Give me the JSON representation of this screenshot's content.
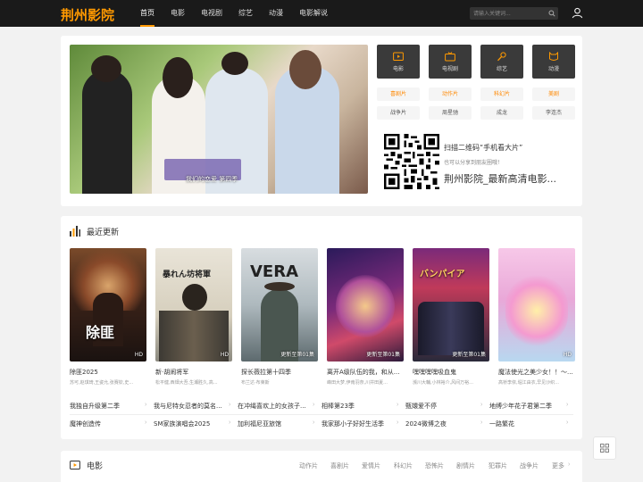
{
  "header": {
    "logo": "荆州影院",
    "nav": [
      "首页",
      "电影",
      "电视剧",
      "综艺",
      "动漫",
      "电影解说"
    ],
    "search_placeholder": "请输入关键词..."
  },
  "hero": {
    "banner_caption": "我们的恋爱 第四季",
    "categories": [
      "电影",
      "电视剧",
      "综艺",
      "动漫"
    ],
    "tags_row1": [
      "喜剧片",
      "动作片",
      "科幻片",
      "美剧"
    ],
    "tags_row2": [
      "战争片",
      "周星驰",
      "成龙",
      "李连杰"
    ],
    "qr_title": "扫描二维码“手机看大片”",
    "qr_desc": "也可以分享到朋友圈哦！",
    "qr_site": "荆州影院_最新高清电影..."
  },
  "recent": {
    "title": "最近更新",
    "movies": [
      {
        "title": "除匪2025",
        "cast": "苏可,赵琪琦,王姿允,张赛钦,史...",
        "badge": "HD",
        "poster_text": "除匪"
      },
      {
        "title": "新·胡闹将军",
        "cast": "松平健,西畑大吾,生瀬胜久,高...",
        "badge": "HD",
        "poster_text": "暴れん坊将軍"
      },
      {
        "title": "探长薇拉第十四季",
        "cast": "布兰达·布莱斯",
        "badge": "更新至第01集",
        "poster_text": "VERA"
      },
      {
        "title": "离开A级队伍的我，和从...",
        "cast": "峰田大梦,伊南羽奈,川井田夏...",
        "badge": "更新至第01集",
        "poster_text": ""
      },
      {
        "title": "嘿嘿嘿嘿吸血鬼",
        "cast": "濒川大輔,小林裕介,风间万裕...",
        "badge": "更新至第01集",
        "poster_text": "バンパイア"
      },
      {
        "title": "魔法使光之美少女！！～...",
        "cast": "高桥李依,堀江由衣,早见沙织...",
        "badge": "HD",
        "poster_text": ""
      }
    ],
    "links_row1": [
      "我独自升级第二季",
      "我与尼特女忍者的莫名...",
      "在冲绳喜欢上的女孩子...",
      "相棒第23季",
      "甄嬛爱不停",
      "地缚少年花子君第二季"
    ],
    "links_row2": [
      "魔神创造传",
      "SM家族演唱会2025",
      "加利福尼亚旅馆",
      "我家那小子好好生活季",
      "2024微博之夜",
      "一路繁花"
    ]
  },
  "movie_section": {
    "title": "电影",
    "tabs": [
      "动作片",
      "喜剧片",
      "爱情片",
      "科幻片",
      "恐怖片",
      "剧情片",
      "犯罪片",
      "战争片",
      "更多"
    ]
  },
  "colors": {
    "accent": "#ff9900",
    "header_bg": "#1a1a1a",
    "tile_bg": "#3a3a3a"
  },
  "icons": [
    "search-icon",
    "user-icon",
    "film-icon",
    "tv-icon",
    "microphone-icon",
    "cat-icon",
    "chart-icon",
    "grid-icon"
  ]
}
